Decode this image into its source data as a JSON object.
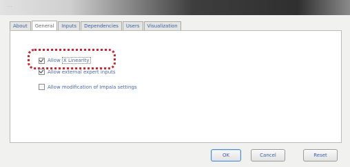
{
  "window": {
    "title": "..."
  },
  "tabs": [
    {
      "label": "About",
      "active": false
    },
    {
      "label": "General",
      "active": true
    },
    {
      "label": "Inputs",
      "active": false
    },
    {
      "label": "Dependencies",
      "active": false
    },
    {
      "label": "Users",
      "active": false
    },
    {
      "label": "Visualization",
      "active": false
    }
  ],
  "general": {
    "checkboxes": [
      {
        "prefix": "Allow",
        "label_boxed": "X Linearity",
        "checked": true
      },
      {
        "label": "Allow external expert inputs",
        "checked": true
      },
      {
        "label": "Allow modification of Impala settings",
        "checked": false
      }
    ],
    "highlight_color": "#d21f2b"
  },
  "buttons": {
    "ok": "OK",
    "cancel": "Cancel",
    "reset": "Reset"
  }
}
